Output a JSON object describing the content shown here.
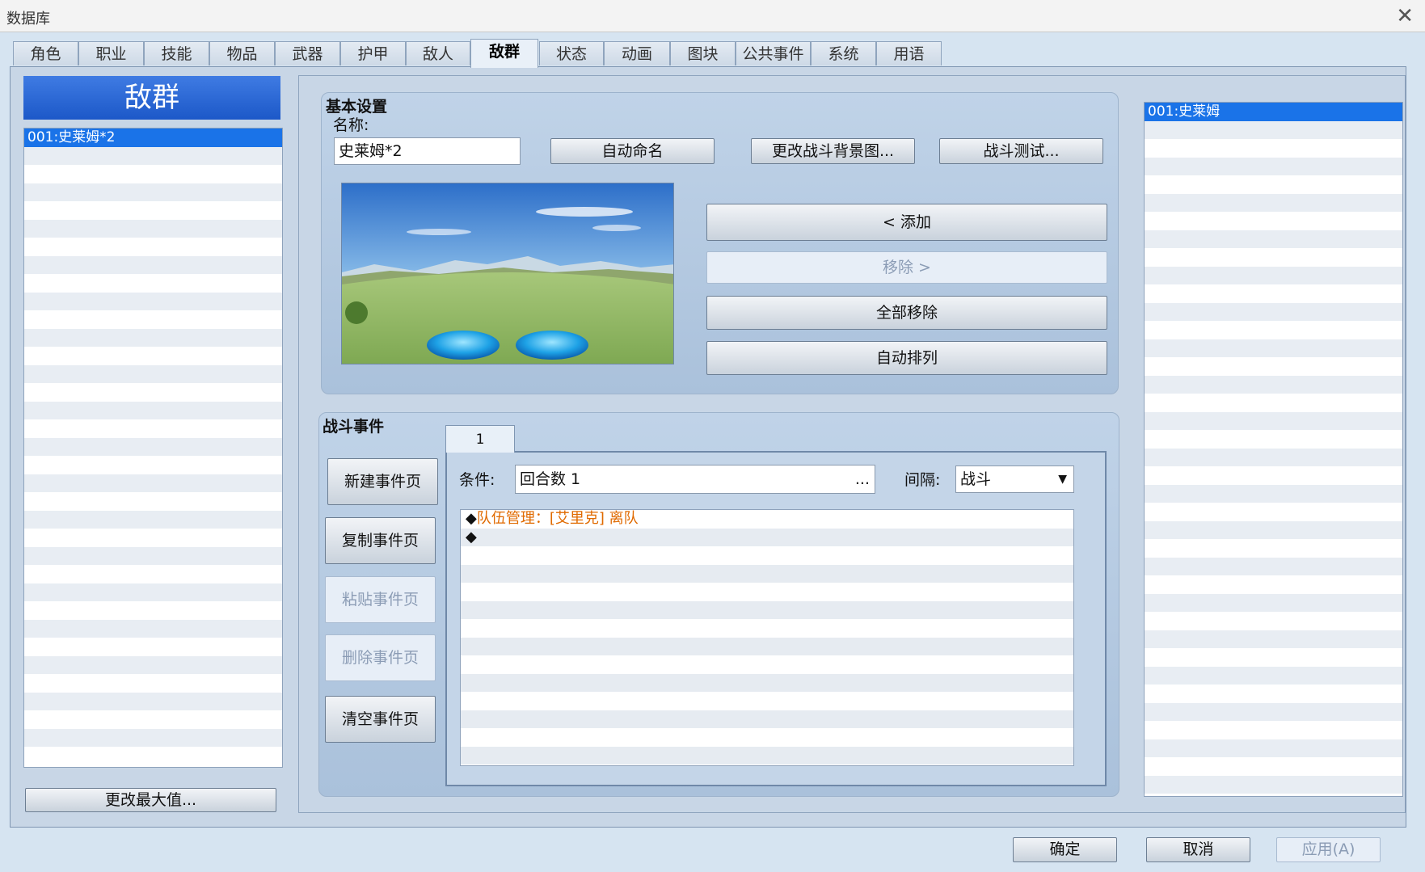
{
  "window": {
    "title": "数据库",
    "close_glyph": "✕"
  },
  "tabs": [
    "角色",
    "职业",
    "技能",
    "物品",
    "武器",
    "护甲",
    "敌人",
    "敌群",
    "状态",
    "动画",
    "图块",
    "公共事件",
    "系统",
    "用语"
  ],
  "active_tab": "敌群",
  "left_panel": {
    "header": "敌群",
    "items": [
      "001:史莱姆*2"
    ],
    "change_max_label": "更改最大值..."
  },
  "basic": {
    "title": "基本设置",
    "name_label": "名称:",
    "name_value": "史莱姆*2",
    "auto_name": "自动命名",
    "change_bg": "更改战斗背景图...",
    "battle_test": "战斗测试...",
    "add": "< 添加",
    "remove": "移除 >",
    "remove_all": "全部移除",
    "auto_arrange": "自动排列"
  },
  "right_list": {
    "items": [
      "001:史莱姆"
    ]
  },
  "battle_events": {
    "title": "战斗事件",
    "new_page": "新建事件页",
    "copy_page": "复制事件页",
    "paste_page": "粘贴事件页",
    "delete_page": "删除事件页",
    "clear_page": "清空事件页",
    "page_tab": "1",
    "condition_label": "条件:",
    "condition_value": "回合数 1",
    "condition_dots": "...",
    "span_label": "间隔:",
    "span_value": "战斗",
    "commands": [
      {
        "marker": "◆",
        "text": "队伍管理：[艾里克] 离队"
      },
      {
        "marker": "◆",
        "text": ""
      }
    ],
    "command_text_color": "#e06a00"
  },
  "footer": {
    "ok": "确定",
    "cancel": "取消",
    "apply": "应用(A)"
  },
  "colors": {
    "selection": "#1a73e8",
    "header": "#1f5cc9"
  }
}
